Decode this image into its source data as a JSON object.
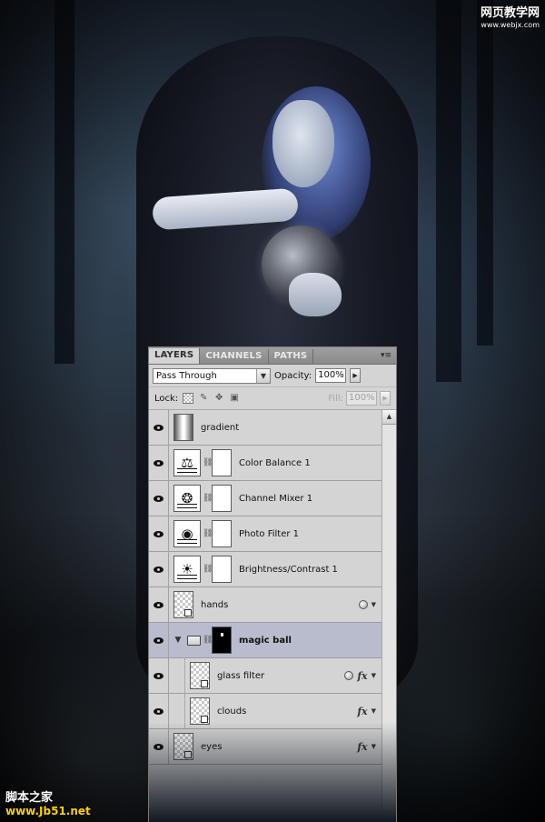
{
  "watermark_top": {
    "line1": "网页教学网",
    "line2": "www.webjx.com"
  },
  "watermark_bottom": {
    "line1": "脚本之家",
    "line2": "www.Jb51.net"
  },
  "panel": {
    "tabs": [
      {
        "label": "LAYERS",
        "active": true
      },
      {
        "label": "CHANNELS",
        "active": false
      },
      {
        "label": "PATHS",
        "active": false
      }
    ],
    "menu_icon": "panel-menu-icon",
    "blend_mode": "Pass Through",
    "opacity_label": "Opacity:",
    "opacity_value": "100%",
    "lock_label": "Lock:",
    "fill_label": "Fill:",
    "fill_value": "100%"
  },
  "layers": [
    {
      "name": "gradient",
      "kind": "pixel",
      "thumb": "gradient"
    },
    {
      "name": "Color Balance 1",
      "kind": "adjustment",
      "icon": "scales-icon"
    },
    {
      "name": "Channel Mixer 1",
      "kind": "adjustment",
      "icon": "channel-mixer-icon"
    },
    {
      "name": "Photo Filter 1",
      "kind": "adjustment",
      "icon": "photo-filter-icon"
    },
    {
      "name": "Brightness/Contrast 1",
      "kind": "adjustment",
      "icon": "brightness-icon"
    },
    {
      "name": "hands",
      "kind": "smart-object",
      "fx": ""
    },
    {
      "name": "magic ball",
      "kind": "group",
      "selected": true
    },
    {
      "name": "glass filter",
      "kind": "smart-object",
      "fx": "fx",
      "child": true
    },
    {
      "name": "clouds",
      "kind": "smart-object",
      "fx": "fx",
      "child": true
    },
    {
      "name": "eyes",
      "kind": "smart-object",
      "fx": "fx"
    }
  ]
}
